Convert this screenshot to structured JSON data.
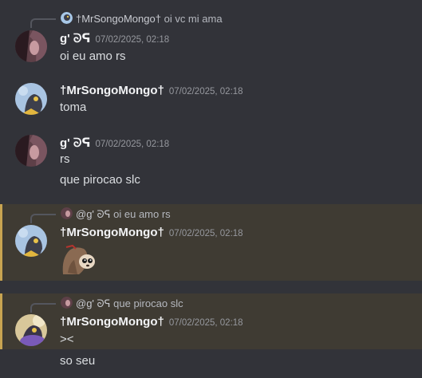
{
  "messages": [
    {
      "reply": {
        "name": "†MrSongoMongo†",
        "text": "oi vc mi ama"
      },
      "author": "g' ᘐᕋ",
      "time": "07/02/2025, 02:18",
      "lines": [
        "oi eu amo rs"
      ]
    },
    {
      "author": "†MrSongoMongo†",
      "time": "07/02/2025, 02:18",
      "lines": [
        "toma"
      ]
    },
    {
      "author": "g' ᘐᕋ",
      "time": "07/02/2025, 02:18",
      "lines": [
        "rs",
        "que pirocao slc"
      ]
    },
    {
      "reply": {
        "name": "@g' ᘐᕋ",
        "text": "oi eu amo rs"
      },
      "author": "†MrSongoMongo†",
      "time": "07/02/2025, 02:18",
      "sticker": "sloth-sticker"
    },
    {
      "reply": {
        "name": "@g' ᘐᕋ",
        "text": "que pirocao slc"
      },
      "author": "†MrSongoMongo†",
      "time": "07/02/2025, 02:18",
      "lines": [
        "><",
        "so seu"
      ]
    }
  ],
  "colors": {
    "background": "#323339",
    "mention_highlight": "#3f3b33",
    "mention_bar": "#c8a451"
  }
}
